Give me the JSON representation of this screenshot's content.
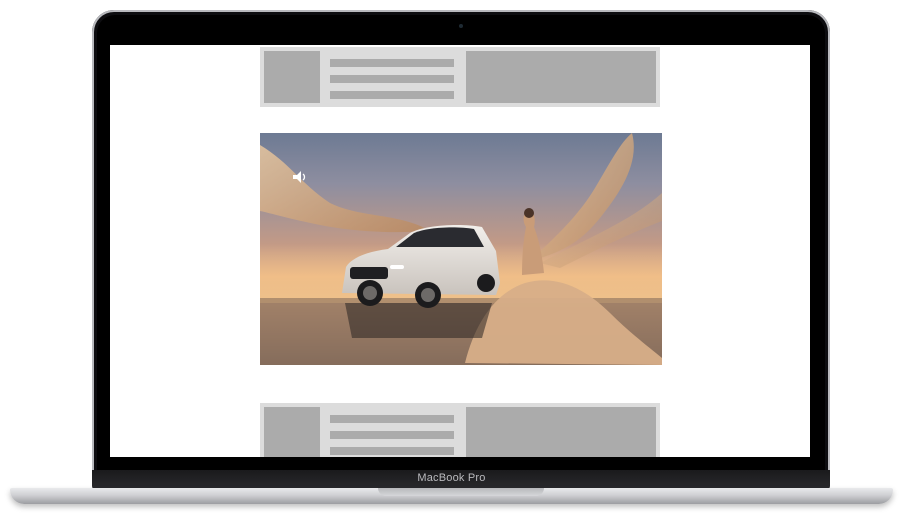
{
  "device": {
    "label": "MacBook Pro"
  },
  "page": {
    "ads": [
      {
        "position": "top"
      },
      {
        "position": "bottom"
      }
    ],
    "hero": {
      "type": "video",
      "icons": {
        "mute": "speaker-icon"
      }
    }
  },
  "colors": {
    "placeholder_light": "#dcdcdc",
    "placeholder_dark": "#ababab",
    "bezel": "#0d0d10"
  }
}
